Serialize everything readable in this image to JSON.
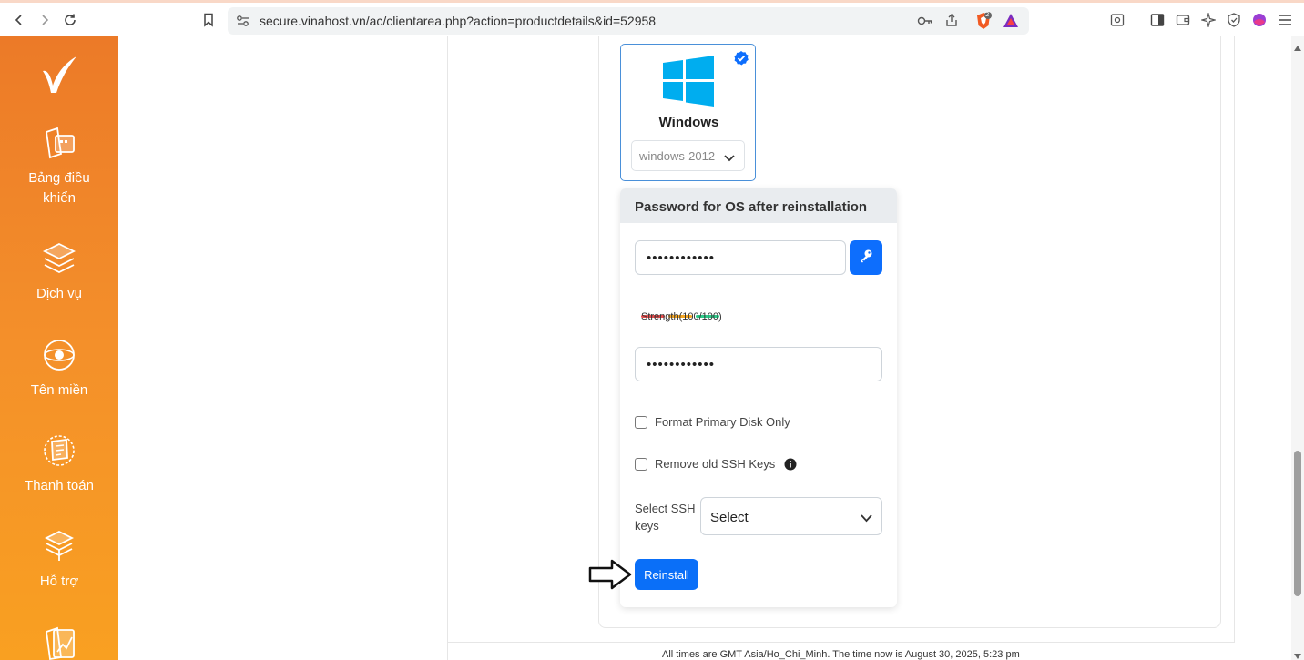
{
  "browser": {
    "url": "secure.vinahost.vn/ac/clientarea.php?action=productdetails&id=52958",
    "icons": [
      "back-icon",
      "forward-icon",
      "reload-icon",
      "bookmark-icon",
      "site-settings-icon",
      "key-icon",
      "share-icon",
      "brave-shield-icon",
      "brave-rewards-icon",
      "reader-icon",
      "sidebar-icon",
      "wallet-icon",
      "leo-icon",
      "vpn-icon",
      "profile-icon",
      "menu-icon"
    ],
    "shield_count": "2"
  },
  "sidebar": {
    "logo": "vinahost-logo",
    "items": [
      {
        "label": "Bảng điều khiển",
        "icon": "dashboard-icon"
      },
      {
        "label": "Dịch vụ",
        "icon": "services-icon"
      },
      {
        "label": "Tên miền",
        "icon": "domain-icon"
      },
      {
        "label": "Thanh toán",
        "icon": "billing-icon"
      },
      {
        "label": "Hỗ trợ",
        "icon": "support-icon"
      }
    ]
  },
  "os": {
    "name": "Windows",
    "version": "windows-2012",
    "selected": true
  },
  "password_card": {
    "title": "Password for OS after reinstallation",
    "password": "••••••••••••",
    "confirm_password": "••••••••••••",
    "strength_text": "Strength(100/100)",
    "strength_colors": [
      "#e74c4c",
      "#f5a623",
      "#2ecc8a"
    ],
    "format_disk_label": "Format Primary Disk Only",
    "remove_ssh_label": "Remove old SSH Keys",
    "ssh_keys_label": "Select SSH keys",
    "ssh_select_value": "Select",
    "reinstall_label": "Reinstall"
  },
  "footer": {
    "text": "All times are GMT Asia/Ho_Chi_Minh. The time now is August 30, 2025, 5:23 pm"
  }
}
